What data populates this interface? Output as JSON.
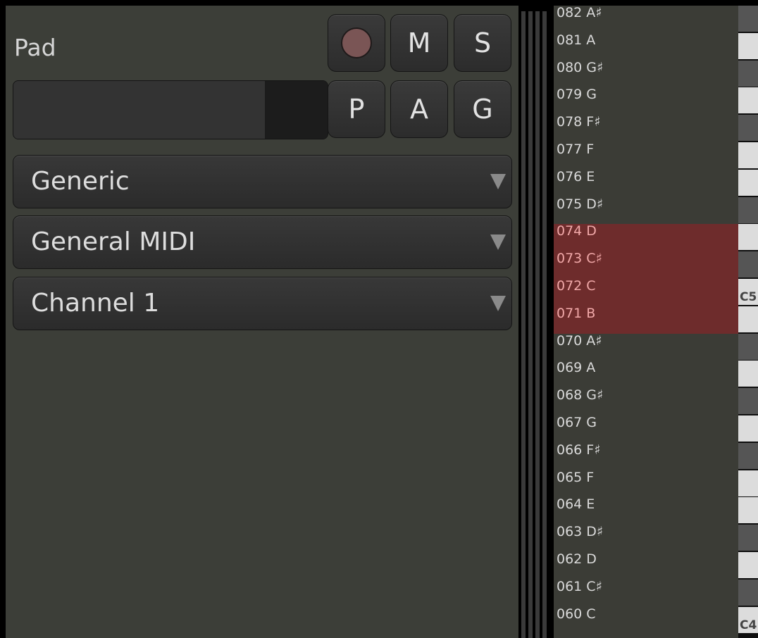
{
  "track": {
    "name": "Pad",
    "buttons": {
      "record": "",
      "mute": "M",
      "solo": "S",
      "playlist": "P",
      "automation": "A",
      "group": "G"
    },
    "meter_level": 0.8
  },
  "combos": [
    {
      "label": "Generic"
    },
    {
      "label": "General MIDI"
    },
    {
      "label": "Channel 1"
    }
  ],
  "notes": [
    {
      "label": "082 A♯",
      "black": true
    },
    {
      "label": "081 A",
      "black": false
    },
    {
      "label": "080 G♯",
      "black": true
    },
    {
      "label": "079 G",
      "black": false
    },
    {
      "label": "078 F♯",
      "black": true
    },
    {
      "label": "077 F",
      "black": false
    },
    {
      "label": "076 E",
      "black": false
    },
    {
      "label": "075 D♯",
      "black": true
    },
    {
      "label": "074 D",
      "black": false,
      "selected": true
    },
    {
      "label": "073 C♯",
      "black": true,
      "selected": true
    },
    {
      "label": "072 C",
      "black": false,
      "selected": true,
      "octave": "C5"
    },
    {
      "label": "071 B",
      "black": false,
      "selected": true
    },
    {
      "label": "070 A♯",
      "black": true
    },
    {
      "label": "069 A",
      "black": false
    },
    {
      "label": "068 G♯",
      "black": true
    },
    {
      "label": "067 G",
      "black": false
    },
    {
      "label": "066 F♯",
      "black": true
    },
    {
      "label": "065 F",
      "black": false
    },
    {
      "label": "064 E",
      "black": false
    },
    {
      "label": "063 D♯",
      "black": true
    },
    {
      "label": "062 D",
      "black": false
    },
    {
      "label": "061 C♯",
      "black": true
    },
    {
      "label": "060 C",
      "black": false,
      "octave": "C4"
    }
  ],
  "colors": {
    "panel_bg": "#3c3e38",
    "selection": "#6e2c2c",
    "selection_text": "#f0a8a8",
    "record_dot": "#7a5555"
  }
}
